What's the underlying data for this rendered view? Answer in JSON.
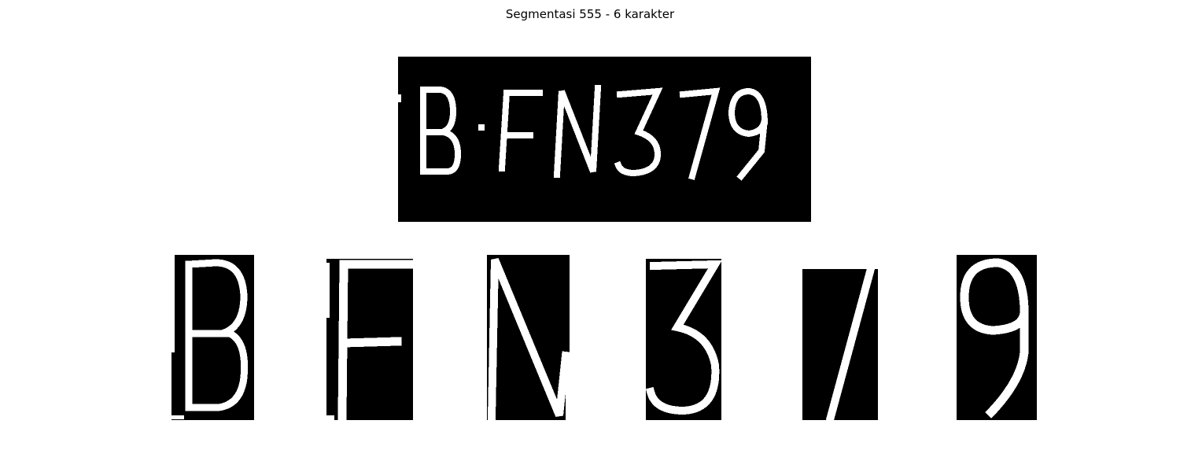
{
  "figure": {
    "title": "Segmentasi 555 - 6 karakter"
  },
  "plate_image": {
    "text": "BFN379"
  },
  "segments": [
    {
      "char": "B"
    },
    {
      "char": "F"
    },
    {
      "char": "N"
    },
    {
      "char": "3"
    },
    {
      "char": "7"
    },
    {
      "char": "9"
    }
  ]
}
